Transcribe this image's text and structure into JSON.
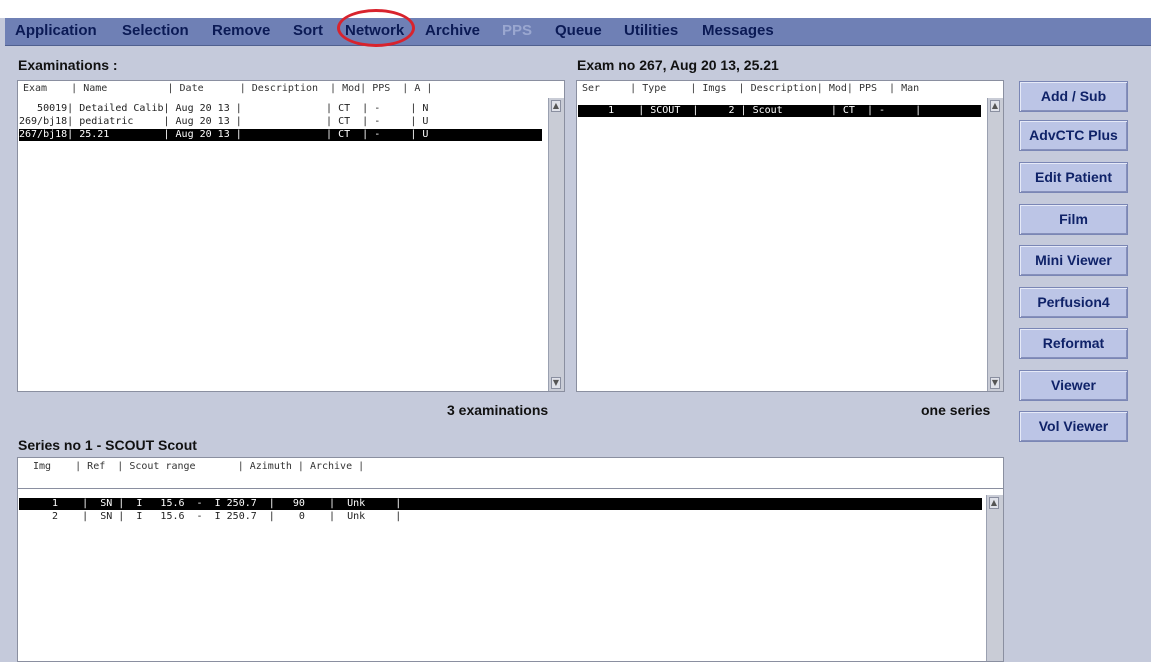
{
  "menu": {
    "items": [
      {
        "label": "Application"
      },
      {
        "label": "Selection"
      },
      {
        "label": "Remove"
      },
      {
        "label": "Sort"
      },
      {
        "label": "Network"
      },
      {
        "label": "Archive"
      },
      {
        "label": "PPS"
      },
      {
        "label": "Queue"
      },
      {
        "label": "Utilities"
      },
      {
        "label": "Messages"
      }
    ],
    "highlight_color": "#d8232d"
  },
  "exams": {
    "title": "Examinations :",
    "header": "Exam    | Name          | Date      | Description  | Mod| PPS  | A |",
    "rows": [
      "   50019| Detailed Calib| Aug 20 13 |              | CT  | -     | N",
      "269/bj18| pediatric     | Aug 20 13 |              | CT  | -     | U",
      "267/bj18| 25.21         | Aug 20 13 |              | CT  | -     | U"
    ],
    "count": "3 examinations"
  },
  "series": {
    "title": "Exam no 267,  Aug 20 13, 25.21",
    "header": "Ser     | Type    | Imgs  | Description| Mod| PPS  | Man",
    "rows": [
      "     1    | SCOUT  |     2 | Scout        | CT  | -     |"
    ],
    "count": "one series"
  },
  "images": {
    "title": "Series no 1 - SCOUT  Scout",
    "header": "Img    | Ref  | Scout range       | Azimuth | Archive |",
    "rows": [
      "   1    |  SN |  I   15.6  -  I 250.7  |   90    |  Unk     |",
      "   2    |  SN |  I   15.6  -  I 250.7  |    0    |  Unk     |"
    ]
  },
  "buttons": {
    "add_sub": "Add / Sub",
    "advctc": "AdvCTC Plus",
    "edit_patient": "Edit Patient",
    "film": "Film",
    "mini_viewer": "Mini Viewer",
    "perfusion": "Perfusion4",
    "reformat": "Reformat",
    "viewer": "Viewer",
    "vol_viewer": "Vol Viewer"
  }
}
